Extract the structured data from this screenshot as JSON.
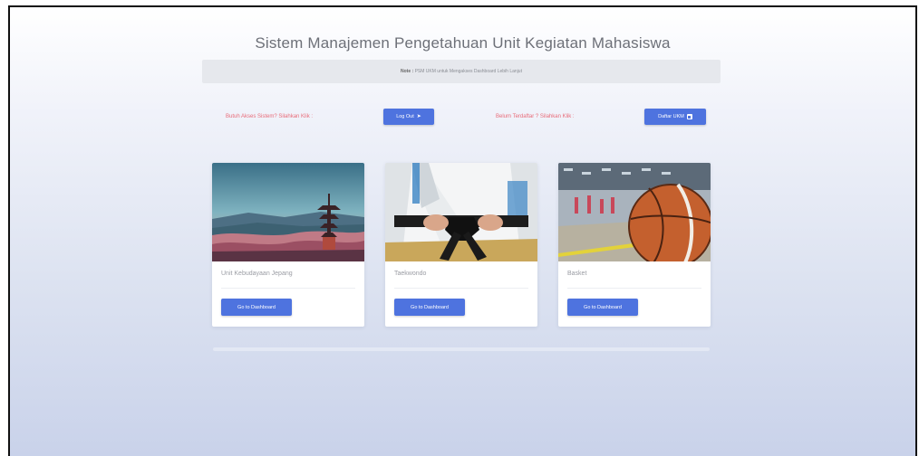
{
  "page": {
    "title": "Sistem Manajemen Pengetahuan Unit Kegiatan Mahasiswa",
    "note_label": "Note :",
    "note_text": "PSM UKM untuk Mengakses Dashboard Lebih Lanjut"
  },
  "auth": {
    "login_prompt": "Butuh Akses Sistem? Silahkan Klik :",
    "login_button": "Log Out",
    "register_prompt": "Belum Terdaftar ? Silahkan Klik :",
    "register_button": "Daftar UKM"
  },
  "cards": [
    {
      "name": "Unit Kebudayaan Jepang",
      "button": "Go to Dashboard",
      "image": "japanese-pagoda-landscape"
    },
    {
      "name": "Taekwondo",
      "button": "Go to Dashboard",
      "image": "black-belt-uniform"
    },
    {
      "name": "Basket",
      "button": "Go to Dashboard",
      "image": "basketball-court"
    }
  ],
  "colors": {
    "accent": "#4e73df",
    "prompt_text": "#e86b79",
    "title_text": "#6d7078"
  }
}
